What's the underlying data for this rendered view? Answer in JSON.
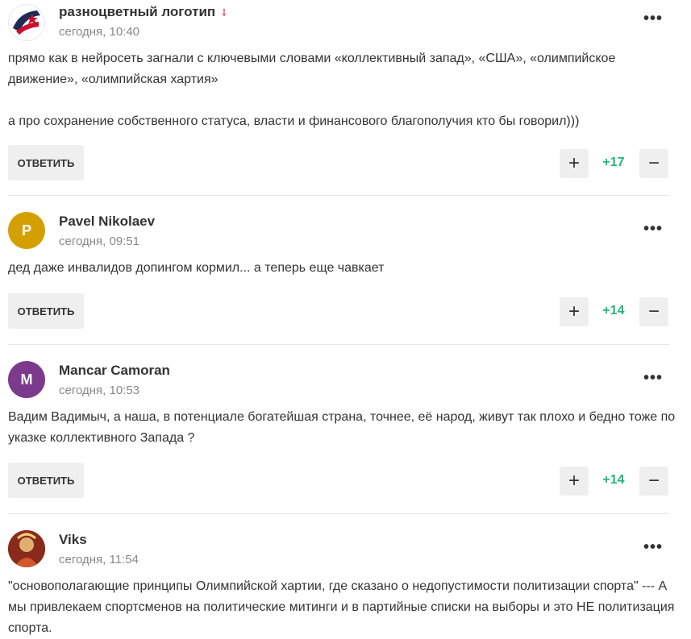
{
  "comments": [
    {
      "author": "разноцветный логотип",
      "flag": "⸸",
      "time": "сегодня, 10:40",
      "avatar_letter": "",
      "avatar_color": "#1f2a55",
      "avatar_icon": "team-logo-icon",
      "text1": "прямо как в нейросеть загнали с ключевыми словами «коллективный запад», «США», «олимпийское движение», «олимпийская хартия»",
      "text2": "а про сохранение собственного статуса, власти и финансового благополучия кто бы говорил)))",
      "reply_label": "ОТВЕТИТЬ",
      "score": "+17"
    },
    {
      "author": "Pavel Nikolaev",
      "time": "сегодня, 09:51",
      "avatar_letter": "P",
      "avatar_color": "#d4a000",
      "text1": "дед даже инвалидов допингом кормил... а теперь еще чавкает",
      "reply_label": "ОТВЕТИТЬ",
      "score": "+14"
    },
    {
      "author": "Mancar Camoran",
      "time": "сегодня, 10:53",
      "avatar_letter": "M",
      "avatar_color": "#7b3a8c",
      "text1": "Вадим Вадимыч, а наша, в потенциале богатейшая страна, точнее, её народ, живут так плохо и бедно тоже по указке коллективного Запада ?",
      "reply_label": "ОТВЕТИТЬ",
      "score": "+14"
    },
    {
      "author": "Viks",
      "time": "сегодня, 11:54",
      "avatar_letter": "",
      "avatar_color": "#b2422a",
      "avatar_icon": "photo-avatar-icon",
      "text1": "\"основополагающие принципы Олимпийской хартии, где сказано о недопустимости политизации спорта\" --- А мы привлекаем спортсменов на политические митинги и в партийные списки на выборы и это НЕ политизация спорта."
    }
  ],
  "ui": {
    "more_glyph": "•••",
    "plus_glyph": "+",
    "minus_glyph": "−"
  }
}
